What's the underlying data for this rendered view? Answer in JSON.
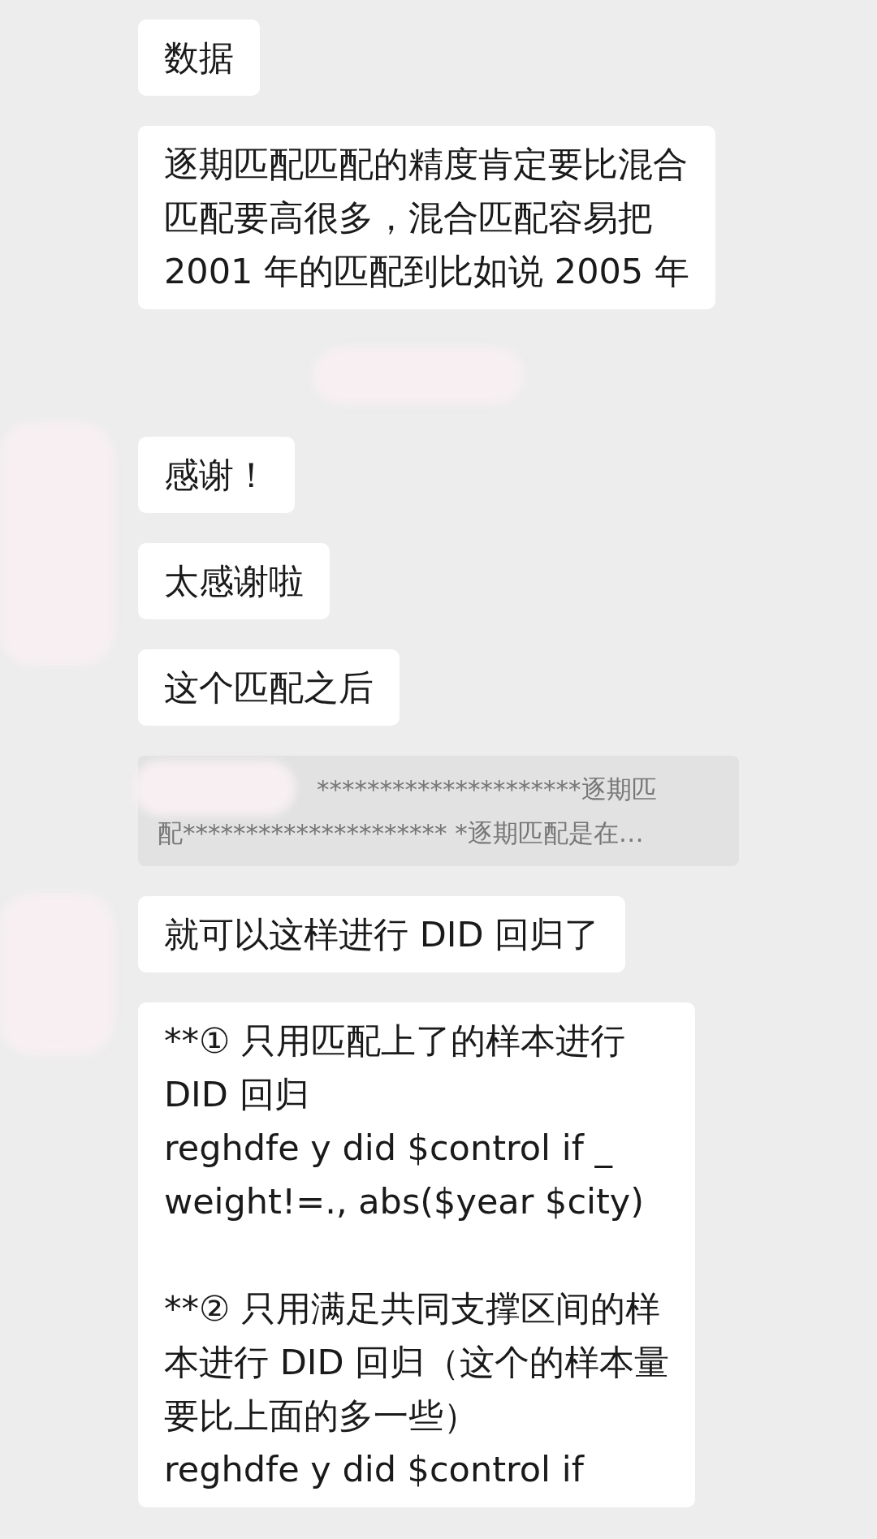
{
  "messages": [
    {
      "kind": "text",
      "paragraphs": [
        [
          "数据"
        ]
      ]
    },
    {
      "kind": "text",
      "paragraphs": [
        [
          "逐期匹配匹配的精度肯定要比混合",
          "匹配要高很多，混合匹配容易把",
          "2001 年的匹配到比如说 2005 年"
        ]
      ]
    },
    {
      "kind": "gap"
    },
    {
      "kind": "text",
      "paragraphs": [
        [
          "感谢！"
        ]
      ]
    },
    {
      "kind": "text",
      "paragraphs": [
        [
          "太感谢啦"
        ]
      ]
    },
    {
      "kind": "text",
      "paragraphs": [
        [
          "这个匹配之后"
        ]
      ]
    },
    {
      "kind": "quote",
      "paragraphs": [
        [
          "*********************逐期匹",
          "配********************* *逐期匹配是在…"
        ]
      ]
    },
    {
      "kind": "text",
      "paragraphs": [
        [
          "就可以这样进行 DID 回归了"
        ]
      ]
    },
    {
      "kind": "text",
      "paragraphs": [
        [
          "**① 只用匹配上了的样本进行",
          "DID 回归",
          "reghdfe y did $control if _",
          "weight!=., abs($year $city)"
        ],
        [
          "**② 只用满足共同支撑区间的样",
          "本进行 DID 回归（这个的样本量",
          "要比上面的多一些）",
          "reghdfe y did $control if"
        ]
      ]
    }
  ]
}
